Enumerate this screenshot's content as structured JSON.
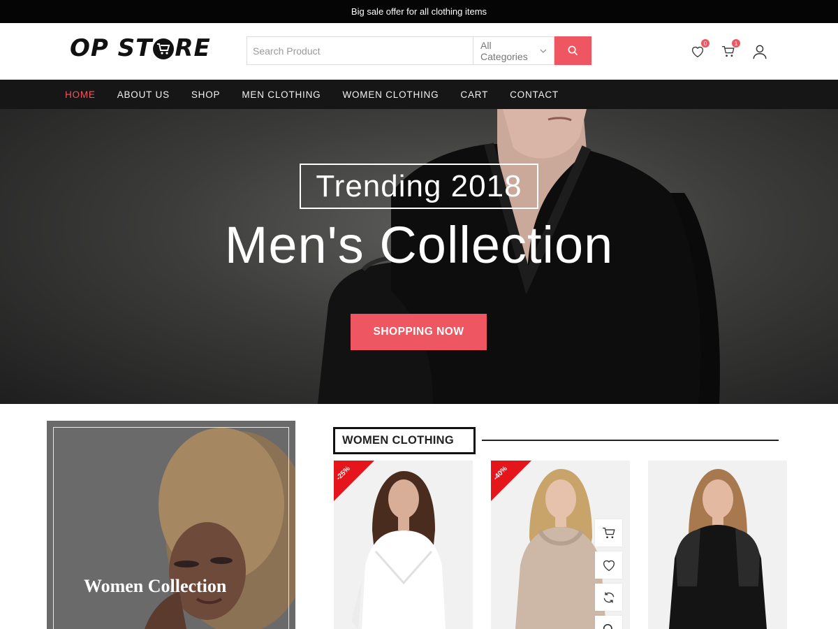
{
  "topbar": {
    "text": "Big sale offer for all clothing items"
  },
  "header": {
    "logo_left": "OP ST",
    "logo_right": "RE",
    "search_placeholder": "Search Product",
    "category": "All Categories",
    "wishlist_count": "0",
    "cart_count": "1"
  },
  "nav": {
    "items": [
      "HOME",
      "ABOUT US",
      "SHOP",
      "MEN CLOTHING",
      "WOMEN CLOTHING",
      "CART",
      "CONTACT"
    ],
    "active": "HOME"
  },
  "hero": {
    "subtitle": "Trending 2018",
    "title": "Men's Collection",
    "button": "SHOPPING NOW"
  },
  "banner": {
    "title": "Women Collection"
  },
  "section": {
    "title": "WOMEN CLOTHING"
  },
  "products": [
    {
      "discount": "-25%",
      "color": "#ffffff"
    },
    {
      "discount": "-40%",
      "color": "#cdb8a8"
    },
    {
      "discount": "",
      "color": "#141414"
    }
  ],
  "colors": {
    "accent": "#ee5761",
    "ribbon": "#e4161b",
    "nav_bg": "#161616",
    "topbar_bg": "#050505"
  }
}
